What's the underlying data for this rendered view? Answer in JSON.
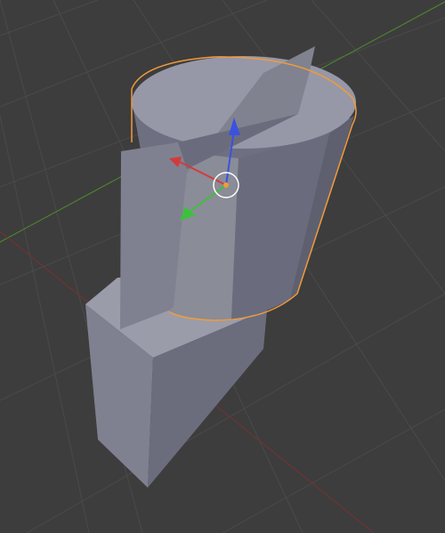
{
  "viewport": {
    "background_color": "#3d3d3d",
    "grid_color": "#4a4a4a",
    "x_axis_color": "#8a3434",
    "y_axis_color": "#4e8a2c",
    "selection_outline_color": "#f29a3a"
  },
  "scene": {
    "objects": [
      {
        "name": "box-base",
        "selected": false,
        "color": "#8a8c98"
      },
      {
        "name": "cylinder-with-fin",
        "selected": true,
        "color": "#8f91a3"
      }
    ]
  },
  "gizmo": {
    "type": "translate",
    "x_color": "#d43a3a",
    "y_color": "#3fbf3f",
    "z_color": "#3a52e0",
    "origin_color": "#f29a3a",
    "ring_color": "#ffffff"
  }
}
